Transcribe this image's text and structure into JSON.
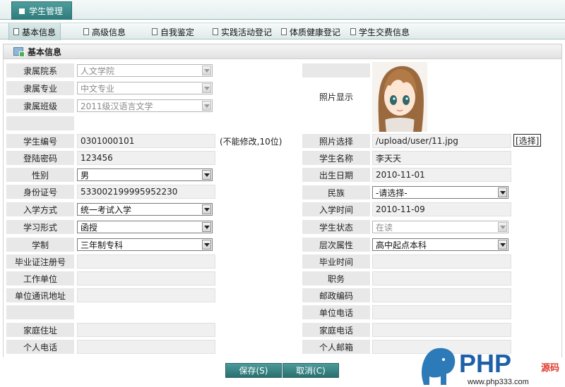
{
  "window": {
    "tab_title": "学生管理"
  },
  "nav": {
    "items": [
      {
        "label": "基本信息"
      },
      {
        "label": "高级信息"
      },
      {
        "label": "自我鉴定"
      },
      {
        "label": "实践活动登记"
      },
      {
        "label": "体质健康登记"
      },
      {
        "label": "学生交费信息"
      }
    ]
  },
  "section": {
    "title": "基本信息"
  },
  "left": {
    "college_label": "隶属院系",
    "college_value": "人文学院",
    "major_label": "隶属专业",
    "major_value": "中文专业",
    "class_label": "隶属班级",
    "class_value": "2011级汉语言文学",
    "student_no_label": "学生编号",
    "student_no_value": "0301000101",
    "student_no_note": "(不能修改,10位)",
    "password_label": "登陆密码",
    "password_value": "123456",
    "gender_label": "性别",
    "gender_value": "男",
    "id_card_label": "身份证号",
    "id_card_value": "533002199995952230",
    "admission_label": "入学方式",
    "admission_value": "统一考试入学",
    "study_form_label": "学习形式",
    "study_form_value": "函授",
    "duration_label": "学制",
    "duration_value": "三年制专科",
    "cert_no_label": "毕业证注册号",
    "cert_no_value": "",
    "employer_label": "工作单位",
    "employer_value": "",
    "employer_addr_label": "单位通讯地址",
    "employer_addr_value": "",
    "home_addr_label": "家庭住址",
    "home_addr_value": "",
    "mobile_label": "个人电话",
    "mobile_value": ""
  },
  "right": {
    "photo_label": "照片显示",
    "photo_select_label": "照片选择",
    "photo_path_value": "/upload/user/11.jpg",
    "photo_select_button": "[选择]",
    "name_label": "学生名称",
    "name_value": "李天天",
    "birth_label": "出生日期",
    "birth_value": "2010-11-01",
    "ethnicity_label": "民族",
    "ethnicity_value": "-请选择-",
    "enroll_label": "入学时间",
    "enroll_value": "2010-11-09",
    "status_label": "学生状态",
    "status_value": "在读",
    "level_label": "层次属性",
    "level_value": "高中起点本科",
    "grad_time_label": "毕业时间",
    "grad_time_value": "",
    "position_label": "职务",
    "position_value": "",
    "zip_label": "邮政编码",
    "zip_value": "",
    "employer_phone_label": "单位电话",
    "employer_phone_value": "",
    "home_phone_label": "家庭电话",
    "home_phone_value": "",
    "email_label": "个人邮箱",
    "email_value": ""
  },
  "actions": {
    "save_label": "保存(S)",
    "cancel_label": "取消(C)"
  },
  "watermark": {
    "brand": "PHP",
    "suffix": "源码",
    "url": "www.php333.com"
  },
  "colors": {
    "accent": "#2e7a7a",
    "label_bg": "#e8e8e8",
    "value_bg": "#f0f0f0"
  }
}
